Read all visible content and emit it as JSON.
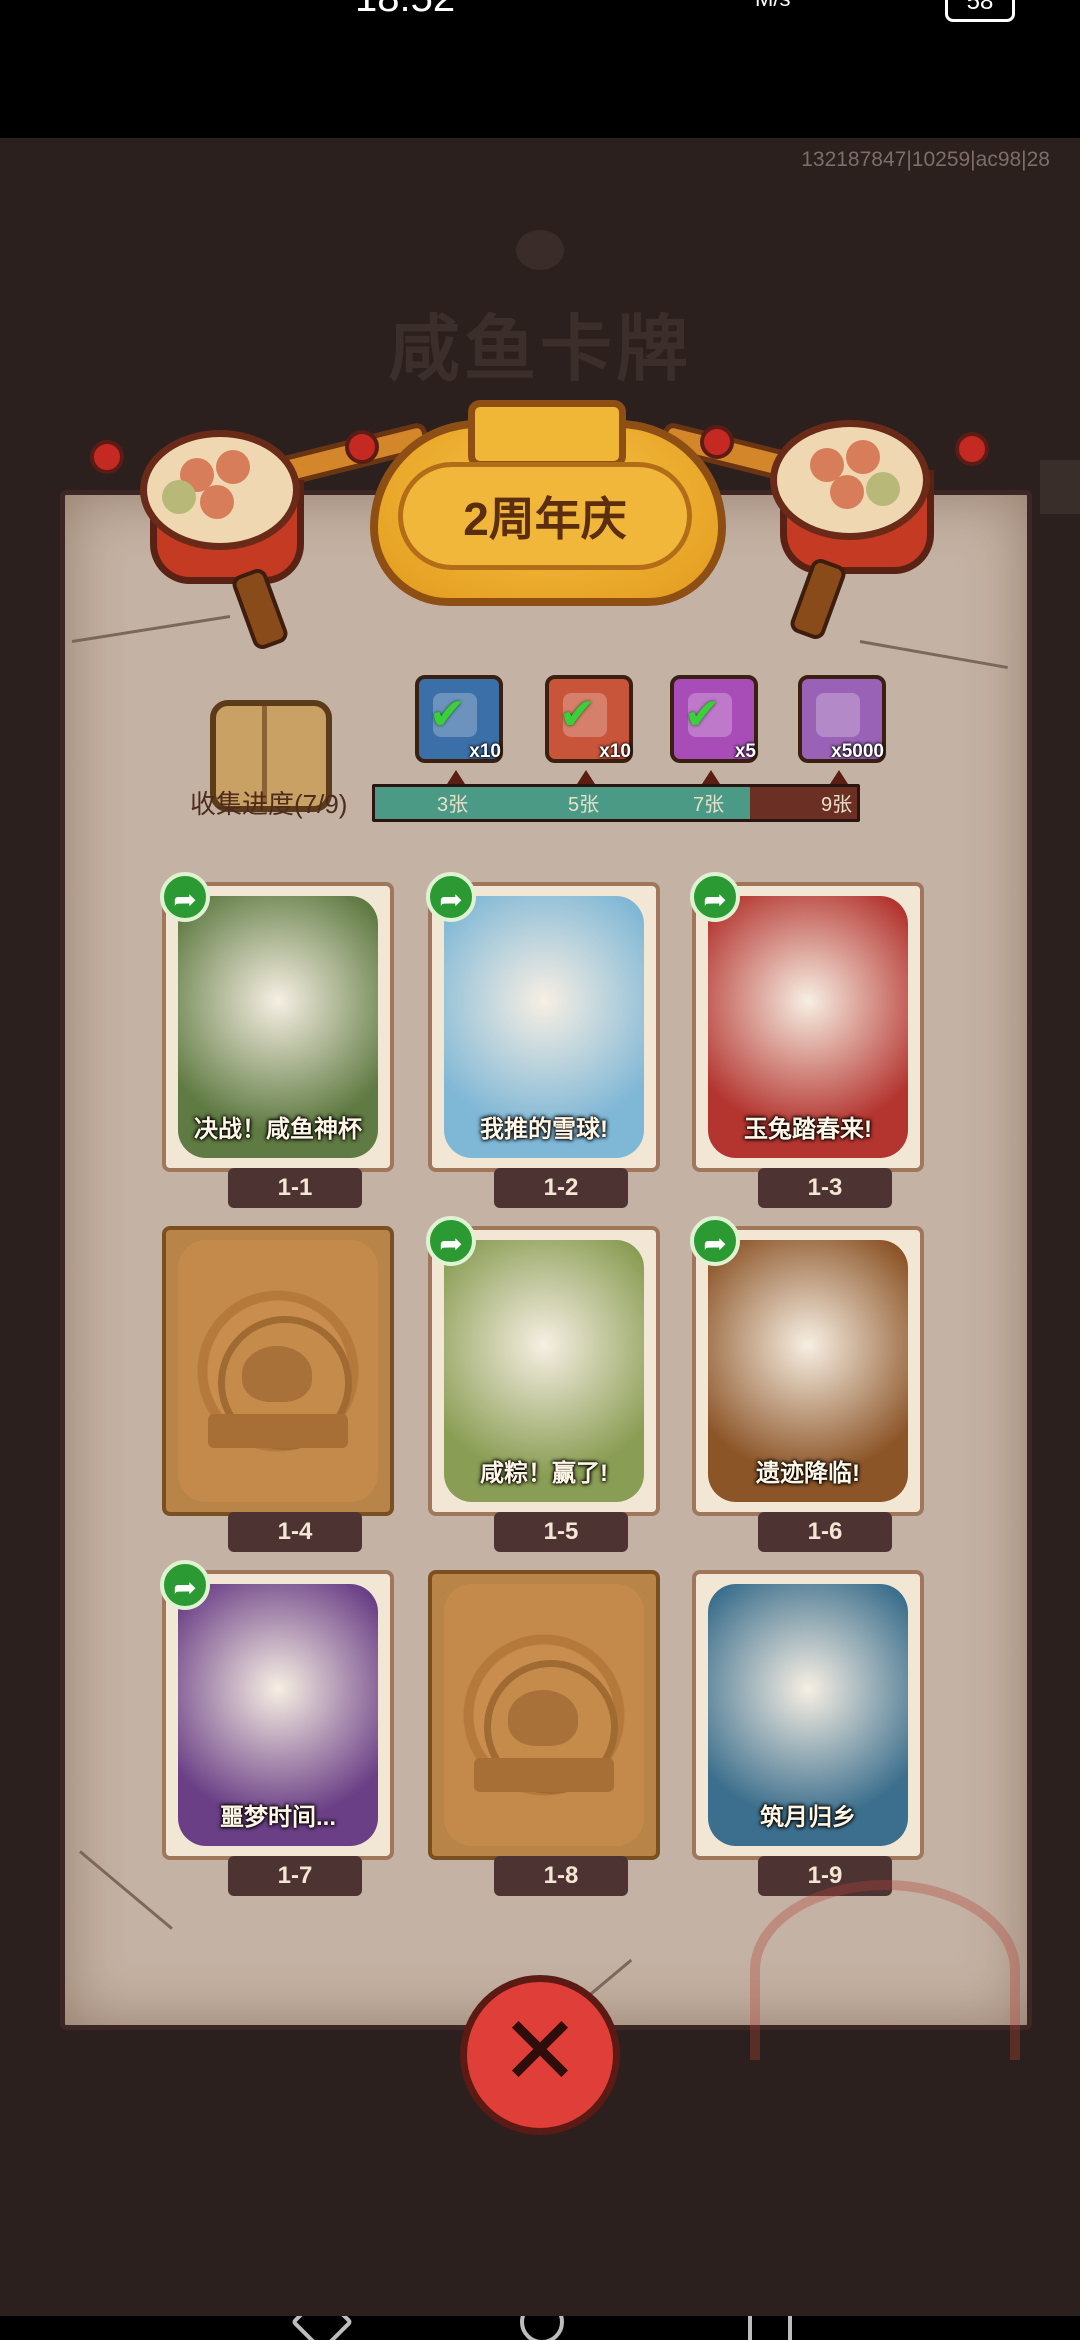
{
  "status_bar": {
    "time": "18:52",
    "network_speed": "M/s",
    "battery": "58"
  },
  "debug_id": "132187847|10259|ac98|28",
  "background_title": "咸鱼卡牌",
  "event": {
    "title": "2周年庆"
  },
  "collection": {
    "progress_label": "收集进度(7/9)",
    "collected": 7,
    "total": 9,
    "milestones": [
      "3张",
      "5张",
      "7张",
      "9张"
    ]
  },
  "rewards": [
    {
      "qty": "x10",
      "icon": "treasure-chest-icon",
      "claimed": true,
      "color": "#3b6fa8"
    },
    {
      "qty": "x10",
      "icon": "scroll-icon",
      "claimed": true,
      "color": "#c8553a"
    },
    {
      "qty": "x5",
      "icon": "orb-icon",
      "claimed": true,
      "color": "#a84db8"
    },
    {
      "qty": "x5000",
      "icon": "gem-icon",
      "claimed": false,
      "color": "#9a62b6"
    }
  ],
  "cards": [
    {
      "num": "1-1",
      "caption": "决战！咸鱼神杯",
      "unlocked": true,
      "shareable": true,
      "bg": "#5f7a42"
    },
    {
      "num": "1-2",
      "caption": "我推的雪球!",
      "unlocked": true,
      "shareable": true,
      "bg": "#7fb7d6"
    },
    {
      "num": "1-3",
      "caption": "玉兔踏春来!",
      "unlocked": true,
      "shareable": true,
      "bg": "#b43530"
    },
    {
      "num": "1-4",
      "caption": "",
      "unlocked": false,
      "shareable": false,
      "bg": "#c08a4c"
    },
    {
      "num": "1-5",
      "caption": "咸粽！赢了!",
      "unlocked": true,
      "shareable": true,
      "bg": "#8a9d54"
    },
    {
      "num": "1-6",
      "caption": "遗迹降临!",
      "unlocked": true,
      "shareable": true,
      "bg": "#8c5528"
    },
    {
      "num": "1-7",
      "caption": "噩梦时间...",
      "unlocked": true,
      "shareable": true,
      "bg": "#6a3f86"
    },
    {
      "num": "1-8",
      "caption": "",
      "unlocked": false,
      "shareable": false,
      "bg": "#c08a4c"
    },
    {
      "num": "1-9",
      "caption": "筑月归乡",
      "unlocked": true,
      "shareable": false,
      "bg": "#3c6f8d"
    }
  ],
  "close_icon": "close-icon"
}
